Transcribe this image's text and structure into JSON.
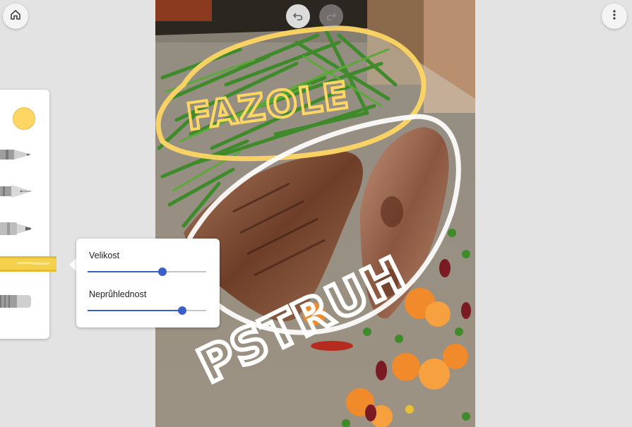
{
  "toolbar": {
    "home_icon": "home-icon",
    "undo_icon": "undo-icon",
    "redo_icon": "redo-icon",
    "more_icon": "more-vert-icon"
  },
  "tools": {
    "selected_color": "#fdd663",
    "items": [
      {
        "name": "pen",
        "icon": "pen-icon"
      },
      {
        "name": "fountain-pen",
        "icon": "fountain-pen-icon"
      },
      {
        "name": "marker",
        "icon": "marker-icon"
      },
      {
        "name": "highlighter",
        "icon": "highlighter-icon",
        "selected": true
      },
      {
        "name": "eraser",
        "icon": "eraser-icon"
      }
    ]
  },
  "brush_settings": {
    "size_label": "Velikost",
    "size_value": 0.63,
    "opacity_label": "Neprůhlednost",
    "opacity_value": 0.8
  },
  "canvas": {
    "annotation_top": "FAZOLE",
    "annotation_bottom": "PSTRUH",
    "annotation_top_color": "#fdd663",
    "annotation_bottom_color": "#ffffff"
  },
  "colors": {
    "accent": "#3b5fc8",
    "background": "#e3e3e3",
    "panel": "#ffffff"
  }
}
